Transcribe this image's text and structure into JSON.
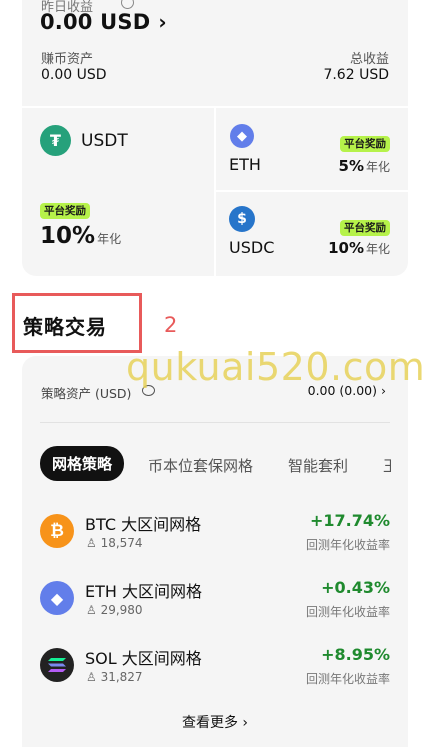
{
  "earnings": {
    "yesterday_label": "昨日收益",
    "total_value": "0.00 USD",
    "chevron": "›",
    "earn_assets_label": "赚币资产",
    "earn_assets_value": "0.00 USD",
    "total_income_label": "总收益",
    "total_income_value": "7.62 USD"
  },
  "coins": [
    {
      "name": "USDT",
      "badge": "",
      "rate": "",
      "unit": "",
      "color": "#26a17b",
      "icon": "usdt-icon"
    },
    {
      "name": "ETH",
      "badge": "平台奖励",
      "rate": "5%",
      "unit": "年化",
      "color": "#627eea",
      "icon": "eth-icon"
    },
    {
      "name": "USDC",
      "badge": "平台奖励",
      "rate": "10%",
      "unit": "年化",
      "color": "#2775ca",
      "icon": "usdc-icon"
    }
  ],
  "usdt_promo": {
    "badge": "平台奖励",
    "rate": "10%",
    "unit": "年化"
  },
  "section": {
    "title": "策略交易",
    "annotation": "2",
    "watermark": "qukuai520.com"
  },
  "strategy": {
    "asset_label": "策略资产 (USD)",
    "asset_value": "0.00 (0.00) ›",
    "tabs": [
      "网格策略",
      "币本位套保网格",
      "智能套利",
      "王"
    ],
    "rows": [
      {
        "name": "BTC 大区间网格",
        "users": "18,574",
        "pct": "+17.74%",
        "sub": "回测年化收益率",
        "color": "#f7931a",
        "icon": "btc-icon"
      },
      {
        "name": "ETH 大区间网格",
        "users": "29,980",
        "pct": "+0.43%",
        "sub": "回测年化收益率",
        "color": "#627eea",
        "icon": "eth-icon"
      },
      {
        "name": "SOL 大区间网格",
        "users": "31,827",
        "pct": "+8.95%",
        "sub": "回测年化收益率",
        "color": "#222222",
        "icon": "sol-icon"
      }
    ],
    "more": "查看更多 ›"
  }
}
